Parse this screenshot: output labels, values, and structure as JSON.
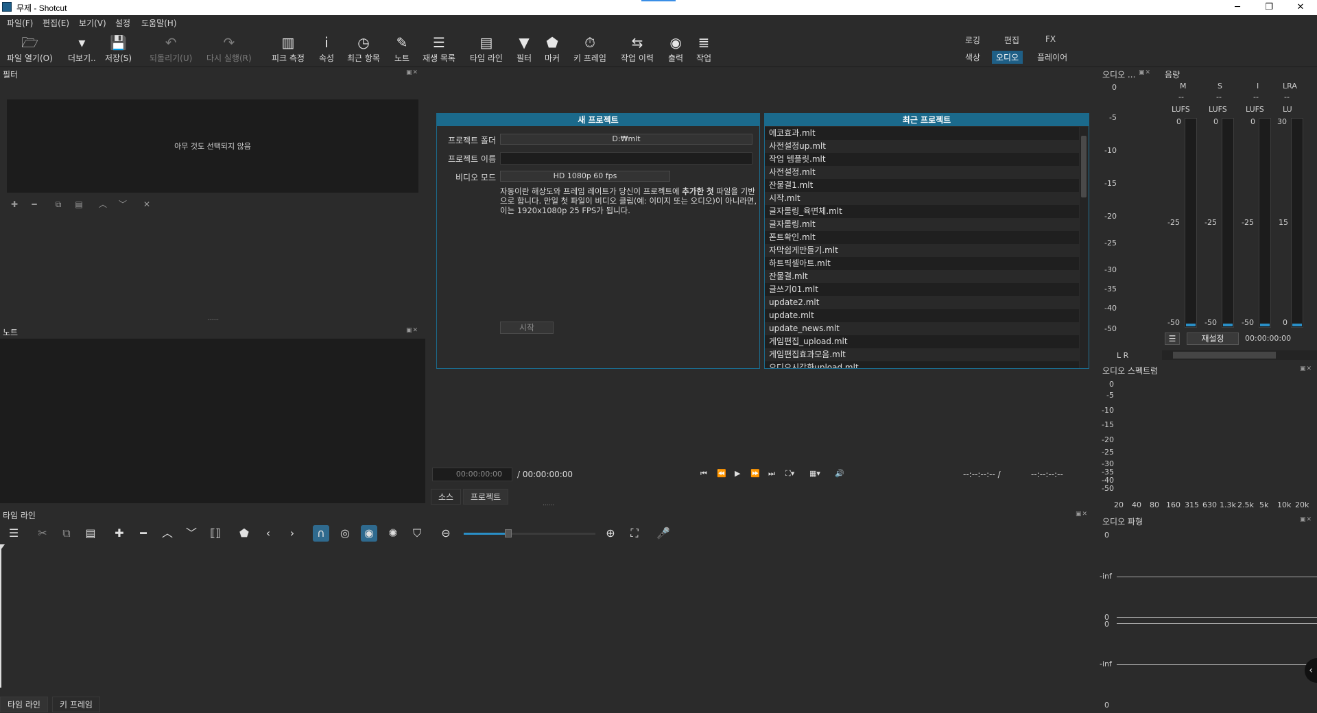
{
  "window": {
    "title": "무제 - Shotcut",
    "minimize": "─",
    "restore": "❐",
    "close": "✕"
  },
  "menu": [
    {
      "label": "파일(F)"
    },
    {
      "label": "편집(E)"
    },
    {
      "label": "보기(V)"
    },
    {
      "label": "설정"
    },
    {
      "label": "도움말(H)"
    }
  ],
  "toolbar": {
    "buttons": [
      {
        "label": "파일 열기(O)",
        "icon": "folder-open-icon",
        "glyph": "🗁"
      },
      {
        "label": "더보기..",
        "icon": "more-icon",
        "glyph": "▾"
      },
      {
        "label": "저장(S)",
        "icon": "save-icon",
        "glyph": "💾"
      },
      {
        "label": "되돌리기(U)",
        "icon": "undo-icon",
        "glyph": "↶"
      },
      {
        "label": "다시 실행(R)",
        "icon": "redo-icon",
        "glyph": "↷"
      },
      {
        "label": "피크 측정",
        "icon": "peak-meter-icon",
        "glyph": "▥"
      },
      {
        "label": "속성",
        "icon": "info-icon",
        "glyph": "i"
      },
      {
        "label": "최근 항목",
        "icon": "clock-icon",
        "glyph": "◷"
      },
      {
        "label": "노트",
        "icon": "note-icon",
        "glyph": "✎"
      },
      {
        "label": "재생 목록",
        "icon": "playlist-icon",
        "glyph": "☰"
      },
      {
        "label": "타임 라인",
        "icon": "timeline-icon",
        "glyph": "▤"
      },
      {
        "label": "필터",
        "icon": "filter-icon",
        "glyph": "▼"
      },
      {
        "label": "마커",
        "icon": "marker-icon",
        "glyph": "⬟"
      },
      {
        "label": "키 프레임",
        "icon": "stopwatch-icon",
        "glyph": "⏱"
      },
      {
        "label": "작업 이력",
        "icon": "history-icon",
        "glyph": "⇆"
      },
      {
        "label": "출력",
        "icon": "disc-icon",
        "glyph": "◉"
      },
      {
        "label": "작업",
        "icon": "jobs-icon",
        "glyph": "≣"
      }
    ],
    "layouts": {
      "logging": "로깅",
      "editing": "편집",
      "fx": "FX",
      "color": "색상",
      "audio": "오디오",
      "player": "플레이어"
    }
  },
  "filters_panel": {
    "title": "필터",
    "empty_text": "아무 것도 선택되지 않음"
  },
  "notes_panel": {
    "title": "노트"
  },
  "new_project": {
    "header": "새 프로젝트",
    "folder_label": "프로젝트 폴더",
    "folder_value": "D:₩mlt",
    "name_label": "프로젝트 이름",
    "name_value": "",
    "mode_label": "비디오 모드",
    "mode_value": "HD 1080p 60 fps",
    "description_1": "자동이란 해상도와 프레임 레이트가 당신이 프로젝트에 ",
    "description_bold": "추가한 첫",
    "description_2": "파일을 기반으로 합니다. 만일 첫 파일이 비디오 클립(예: 이미지 또는 오디오)이 아니라면, 이는 1920x1080p 25 FPS가 됩니다.",
    "start_button": "시작"
  },
  "recent_projects": {
    "header": "최근 프로젝트",
    "items": [
      "에코효과.mlt",
      "사전설정up.mlt",
      "작업 템플릿.mlt",
      "사전설정.mlt",
      "잔물결1.mlt",
      "시작.mlt",
      "글자롤링_육면체.mlt",
      "글자롤링.mlt",
      "폰트확인.mlt",
      "자막쉽게만들기.mlt",
      "하트픽셀아트.mlt",
      "잔물결.mlt",
      "글쓰기01.mlt",
      "update2.mlt",
      "update.mlt",
      "update_news.mlt",
      "게임편집_upload.mlt",
      "게임편집효과모음.mlt",
      "오디오시각화upload.mlt"
    ]
  },
  "transport": {
    "timecode": "00:00:00:00",
    "duration": "/ 00:00:00:00",
    "in_point": "--:--:--:-- /",
    "out_point": "--:--:--:--",
    "tab_source": "소스",
    "tab_project": "프로젝트"
  },
  "timeline": {
    "title": "타임 라인",
    "bottom_tabs": [
      "타임 라인",
      "키 프레임"
    ]
  },
  "audio_peak": {
    "title": "오디오 ...",
    "scale": [
      "0",
      "-5",
      "-10",
      "-15",
      "-20",
      "-25",
      "-30",
      "-35",
      "-40",
      "-50"
    ],
    "lr": "L  R"
  },
  "loudness": {
    "title": "음량",
    "columns": [
      "M",
      "S",
      "I",
      "LRA"
    ],
    "dashes": [
      "--",
      "--",
      "--",
      "--"
    ],
    "units": [
      "LUFS",
      "LUFS",
      "LUFS",
      "LU"
    ],
    "top_values": [
      "0",
      "0",
      "0",
      "30"
    ],
    "mid_values": [
      "-25",
      "-25",
      "-25",
      "15"
    ],
    "bottom_values": [
      "-50",
      "-50",
      "-50",
      "0"
    ],
    "reset_label": "재설정",
    "time": "00:00:00:00"
  },
  "spectrum": {
    "title": "오디오 스펙트럼",
    "y_labels": [
      "0",
      "-5",
      "-10",
      "-15",
      "-20",
      "-25",
      "-30",
      "-35",
      "-40",
      "-50"
    ],
    "x_labels": [
      "20",
      "40",
      "80",
      "160",
      "315",
      "630",
      "1.3k",
      "2.5k",
      "5k",
      "10k",
      "20k"
    ]
  },
  "waveform": {
    "title": "오디오 파형",
    "labels": [
      "0",
      "-inf",
      "0",
      "0",
      "-inf",
      "0"
    ]
  }
}
